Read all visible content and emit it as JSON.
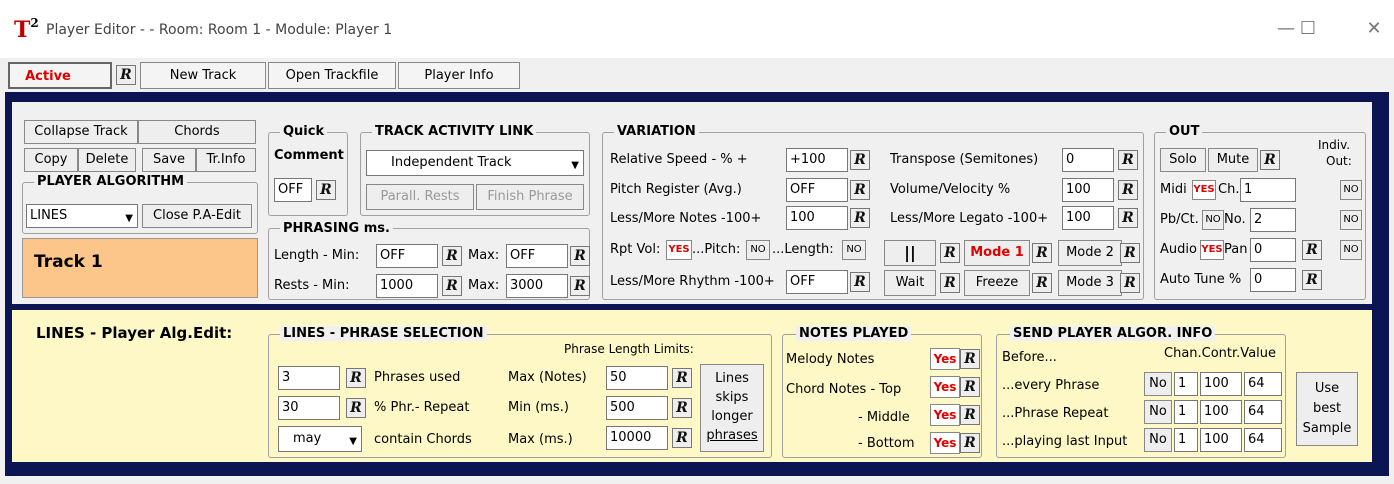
{
  "window": {
    "logo": "T",
    "logo_sup": "2",
    "title": "Player Editor - - Room: Room  1 - Module: Player 1",
    "minimize": "—",
    "maximize": "☐",
    "close": "✕"
  },
  "tabs": {
    "active": "Active",
    "r": "R",
    "new_track": "New Track",
    "open_trackfile": "Open Trackfile",
    "player_info": "Player Info"
  },
  "track": {
    "collapse": "Collapse Track",
    "chords": "Chords",
    "copy": "Copy",
    "delete": "Delete",
    "save": "Save",
    "trinfo": "Tr.Info",
    "algo_label": "PLAYER ALGORITHM",
    "algo_value": "LINES",
    "close_pa": "Close P.A-Edit",
    "name": "Track 1"
  },
  "quick": {
    "label": "Quick",
    "comment": "Comment",
    "value": "OFF",
    "r": "R"
  },
  "activity": {
    "label": "TRACK ACTIVITY LINK",
    "value": "Independent Track",
    "parall": "Parall. Rests",
    "finish": "Finish Phrase"
  },
  "phrasing": {
    "label": "PHRASING ms.",
    "length": "Length  -  Min:",
    "rests": "Rests   -   Min:",
    "max": "Max:",
    "len_min": "OFF",
    "len_max": "OFF",
    "rest_min": "1000",
    "rest_max": "3000",
    "r": "R"
  },
  "variation": {
    "label": "VARIATION",
    "speed": "Relative Speed - % +",
    "speed_v": "+100",
    "pitch": "Pitch Register (Avg.)",
    "pitch_v": "OFF",
    "notes": "Less/More Notes -100+",
    "notes_v": "100",
    "rpt": "Rpt Vol:",
    "rpt_yes": "YES",
    "pitch2": "...Pitch:",
    "pitch2_no": "NO",
    "len2": "...Length:",
    "len2_no": "NO",
    "rhythm": "Less/More Rhythm -100+",
    "rhythm_v": "OFF",
    "transpose": "Transpose (Semitones)",
    "transpose_v": "0",
    "volume": "Volume/Velocity %",
    "volume_v": "100",
    "legato": "Less/More Legato -100+",
    "legato_v": "100",
    "pause": "||",
    "mode1": "Mode 1",
    "mode2": "Mode 2",
    "mode3": "Mode 3",
    "wait": "Wait",
    "freeze": "Freeze",
    "r": "R"
  },
  "out": {
    "label": "OUT",
    "indiv": "Indiv.",
    "indiv2": "Out:",
    "solo": "Solo",
    "mute": "Mute",
    "midi": "Midi",
    "midi_yes": "YES",
    "ch": "Ch.",
    "ch_v": "1",
    "pbct": "Pb/Ct.",
    "pbct_no": "NO",
    "no": "No.",
    "no_v": "2",
    "audio": "Audio",
    "audio_yes": "YES",
    "pan": "Pan",
    "pan_v": "0",
    "autotune": "Auto Tune %",
    "autotune_v": "0",
    "nobtn": "NO",
    "r": "R"
  },
  "lines": {
    "title": "LINES  -  Player Alg.Edit:",
    "sel_label": "LINES  -  PHRASE SELECTION",
    "limits": "Phrase Length Limits:",
    "v1": "3",
    "v2": "30",
    "v3": "may",
    "l1": "Phrases used",
    "l2": "% Phr.- Repeat",
    "l3": "contain Chords",
    "m1": "Max (Notes)",
    "m2": "Min (ms.)",
    "m3": "Max (ms.)",
    "n1": "50",
    "n2": "500",
    "n3": "10000",
    "skip": [
      "Lines",
      "skips",
      "longer",
      "phrases"
    ],
    "r": "R"
  },
  "notes": {
    "label": "NOTES PLAYED",
    "melody": "Melody Notes",
    "top": "Chord Notes - Top",
    "middle": "- Middle",
    "bottom": "- Bottom",
    "yes": "Yes",
    "r": "R"
  },
  "send": {
    "label": "SEND PLAYER ALGOR. INFO",
    "before": "Before...",
    "hdr": "Chan.Contr.Value",
    "every": "...every Phrase",
    "repeat": "...Phrase Repeat",
    "last": "...playing last Input",
    "no": "No",
    "chan": "1",
    "contr": "100",
    "value": "64",
    "use": [
      "Use",
      "best",
      "Sample"
    ]
  }
}
